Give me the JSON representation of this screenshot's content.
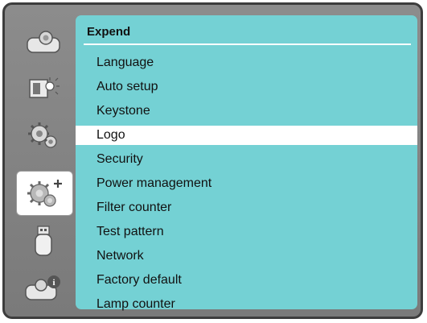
{
  "panel": {
    "title": "Expend"
  },
  "menu": {
    "selected_index": 3,
    "items": [
      {
        "label": "Language"
      },
      {
        "label": "Auto setup"
      },
      {
        "label": "Keystone"
      },
      {
        "label": "Logo"
      },
      {
        "label": "Security"
      },
      {
        "label": "Power management"
      },
      {
        "label": "Filter counter"
      },
      {
        "label": "Test pattern"
      },
      {
        "label": "Network"
      },
      {
        "label": "Factory default"
      },
      {
        "label": "Lamp counter"
      }
    ]
  },
  "sidebar": {
    "active_index": 3,
    "items": [
      {
        "icon": "projector-icon"
      },
      {
        "icon": "screen-light-icon"
      },
      {
        "icon": "gear-icon"
      },
      {
        "icon": "gear-plus-icon"
      },
      {
        "icon": "usb-memory-icon"
      },
      {
        "icon": "projector-info-icon"
      }
    ]
  },
  "colors": {
    "panel": "#74d1d4",
    "frame": "#7a7a7a",
    "selected_row": "#ffffff"
  }
}
